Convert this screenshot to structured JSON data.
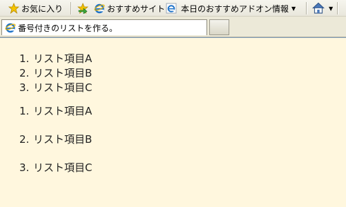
{
  "favorites_bar": {
    "favorites_label": "お気に入り",
    "suggested_sites_label": "おすすめサイト",
    "addons_label": "本日のおすすめアドオン情報"
  },
  "tab": {
    "title": "番号付きのリストを作る。"
  },
  "content": {
    "list1": [
      {
        "num": "1.",
        "text": "リスト項目A"
      },
      {
        "num": "2.",
        "text": "リスト項目B"
      },
      {
        "num": "3.",
        "text": "リスト項目C"
      }
    ],
    "list2": [
      {
        "num": "1.",
        "text": "リスト項目A"
      },
      {
        "num": "2.",
        "text": "リスト項目B"
      },
      {
        "num": "3.",
        "text": "リスト項目C"
      }
    ]
  },
  "colors": {
    "page_background": "#FFF7DE",
    "chrome_background": "#ECE9D8"
  },
  "icons": [
    "star-icon",
    "add-favorite-icon",
    "ie-icon",
    "ie-addon-icon",
    "home-icon"
  ]
}
